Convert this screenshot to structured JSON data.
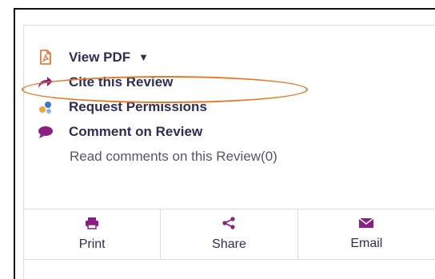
{
  "links": {
    "view_pdf": "View PDF",
    "cite": "Cite this Review",
    "permissions": "Request Permissions",
    "comment": "Comment on Review",
    "read_comments": "Read comments on this Review(0)"
  },
  "actions": {
    "print": "Print",
    "share": "Share",
    "email": "Email"
  },
  "colors": {
    "accent": "#8b1e85",
    "highlight": "#e87722",
    "pdf": "#e8652a",
    "text": "#2d2d5a"
  },
  "icons": [
    "pdf-icon",
    "share-arrow-icon",
    "permissions-icon",
    "comment-icon",
    "print-icon",
    "share-icon",
    "email-icon"
  ]
}
